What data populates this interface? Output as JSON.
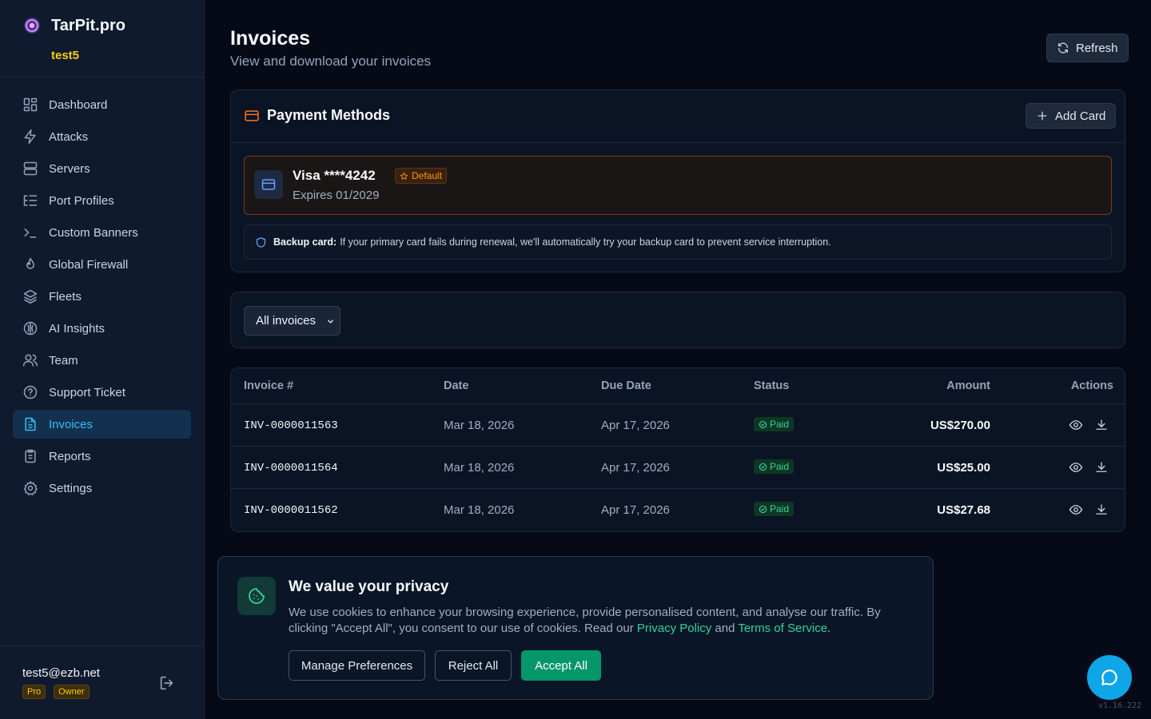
{
  "app": {
    "name": "TarPit.pro",
    "org": "test5",
    "version": "v1.16.222"
  },
  "sidebar": {
    "items": [
      {
        "label": "Dashboard",
        "icon": "dashboard-icon"
      },
      {
        "label": "Attacks",
        "icon": "bolt-icon"
      },
      {
        "label": "Servers",
        "icon": "server-icon"
      },
      {
        "label": "Port Profiles",
        "icon": "list-tree-icon"
      },
      {
        "label": "Custom Banners",
        "icon": "terminal-icon"
      },
      {
        "label": "Global Firewall",
        "icon": "flame-icon"
      },
      {
        "label": "Fleets",
        "icon": "layers-icon"
      },
      {
        "label": "AI Insights",
        "icon": "brain-icon"
      },
      {
        "label": "Team",
        "icon": "users-icon"
      },
      {
        "label": "Support Ticket",
        "icon": "help-circle-icon"
      },
      {
        "label": "Invoices",
        "icon": "file-text-icon",
        "active": true
      },
      {
        "label": "Reports",
        "icon": "clipboard-icon"
      },
      {
        "label": "Settings",
        "icon": "gear-icon"
      }
    ],
    "user": {
      "email": "test5@ezb.net",
      "plan": "Pro",
      "role": "Owner"
    }
  },
  "page": {
    "title": "Invoices",
    "subtitle": "View and download your invoices",
    "refresh_label": "Refresh"
  },
  "payment_methods": {
    "title": "Payment Methods",
    "add_label": "Add Card",
    "card": {
      "name": "Visa ****4242",
      "badge": "Default",
      "expires": "Expires 01/2029"
    },
    "backup": {
      "label": "Backup card:",
      "text": "If your primary card fails during renewal, we'll automatically try your backup card to prevent service interruption."
    }
  },
  "filter": {
    "selected": "All invoices"
  },
  "invoices": {
    "headers": {
      "number": "Invoice #",
      "date": "Date",
      "due": "Due Date",
      "status": "Status",
      "amount": "Amount",
      "actions": "Actions"
    },
    "rows": [
      {
        "number": "INV-0000011563",
        "date": "Mar 18, 2026",
        "due": "Apr 17, 2026",
        "status": "Paid",
        "amount": "US$270.00"
      },
      {
        "number": "INV-0000011564",
        "date": "Mar 18, 2026",
        "due": "Apr 17, 2026",
        "status": "Paid",
        "amount": "US$25.00"
      },
      {
        "number": "INV-0000011562",
        "date": "Mar 18, 2026",
        "due": "Apr 17, 2026",
        "status": "Paid",
        "amount": "US$27.68"
      }
    ]
  },
  "cookie": {
    "title": "We value your privacy",
    "text_before": "We use cookies to enhance your browsing experience, provide personalised content, and analyse our traffic. By clicking \"Accept All\", you consent to our use of cookies. Read our ",
    "privacy_link": "Privacy Policy",
    "and": " and ",
    "terms_link": "Terms of Service",
    "period": ".",
    "manage_label": "Manage Preferences",
    "reject_label": "Reject All",
    "accept_label": "Accept All"
  },
  "colors": {
    "accent": "#38bdf8",
    "brand_yellow": "#facc15",
    "success": "#34d399",
    "primary_btn": "#059669"
  }
}
